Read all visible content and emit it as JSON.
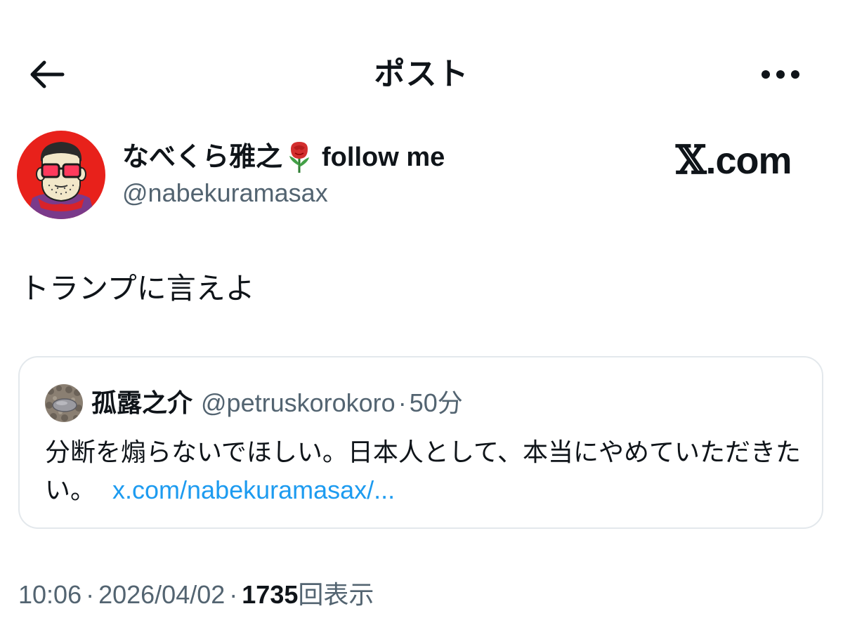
{
  "header": {
    "title": "ポスト",
    "back_icon": "arrow-left-icon",
    "more_icon": "more-horizontal-icon"
  },
  "author": {
    "display_name": "なべくら雅之",
    "name_suffix": "follow me",
    "name_emoji": "rose-icon",
    "handle": "@nabekuramasax"
  },
  "watermark": {
    "x": "𝕏",
    "text": ".com"
  },
  "post": {
    "text": "トランプに言えよ"
  },
  "quote": {
    "name": "孤露之介",
    "handle": "@petruskorokoro",
    "separator": "·",
    "time": "50分",
    "text": "分断を煽らないでほしい。日本人として、本当にやめていただきたい。",
    "link": "x.com/nabekuramasax/..."
  },
  "meta": {
    "time": "10:06",
    "separator": "·",
    "date": "2026/04/02",
    "separator2": "·",
    "views_count": "1735",
    "views_label": "回表示"
  },
  "colors": {
    "text_primary": "#0f1419",
    "text_secondary": "#536471",
    "link": "#1d9bf0",
    "border": "#e3e8ec",
    "avatar_bg": "#e8211b"
  }
}
